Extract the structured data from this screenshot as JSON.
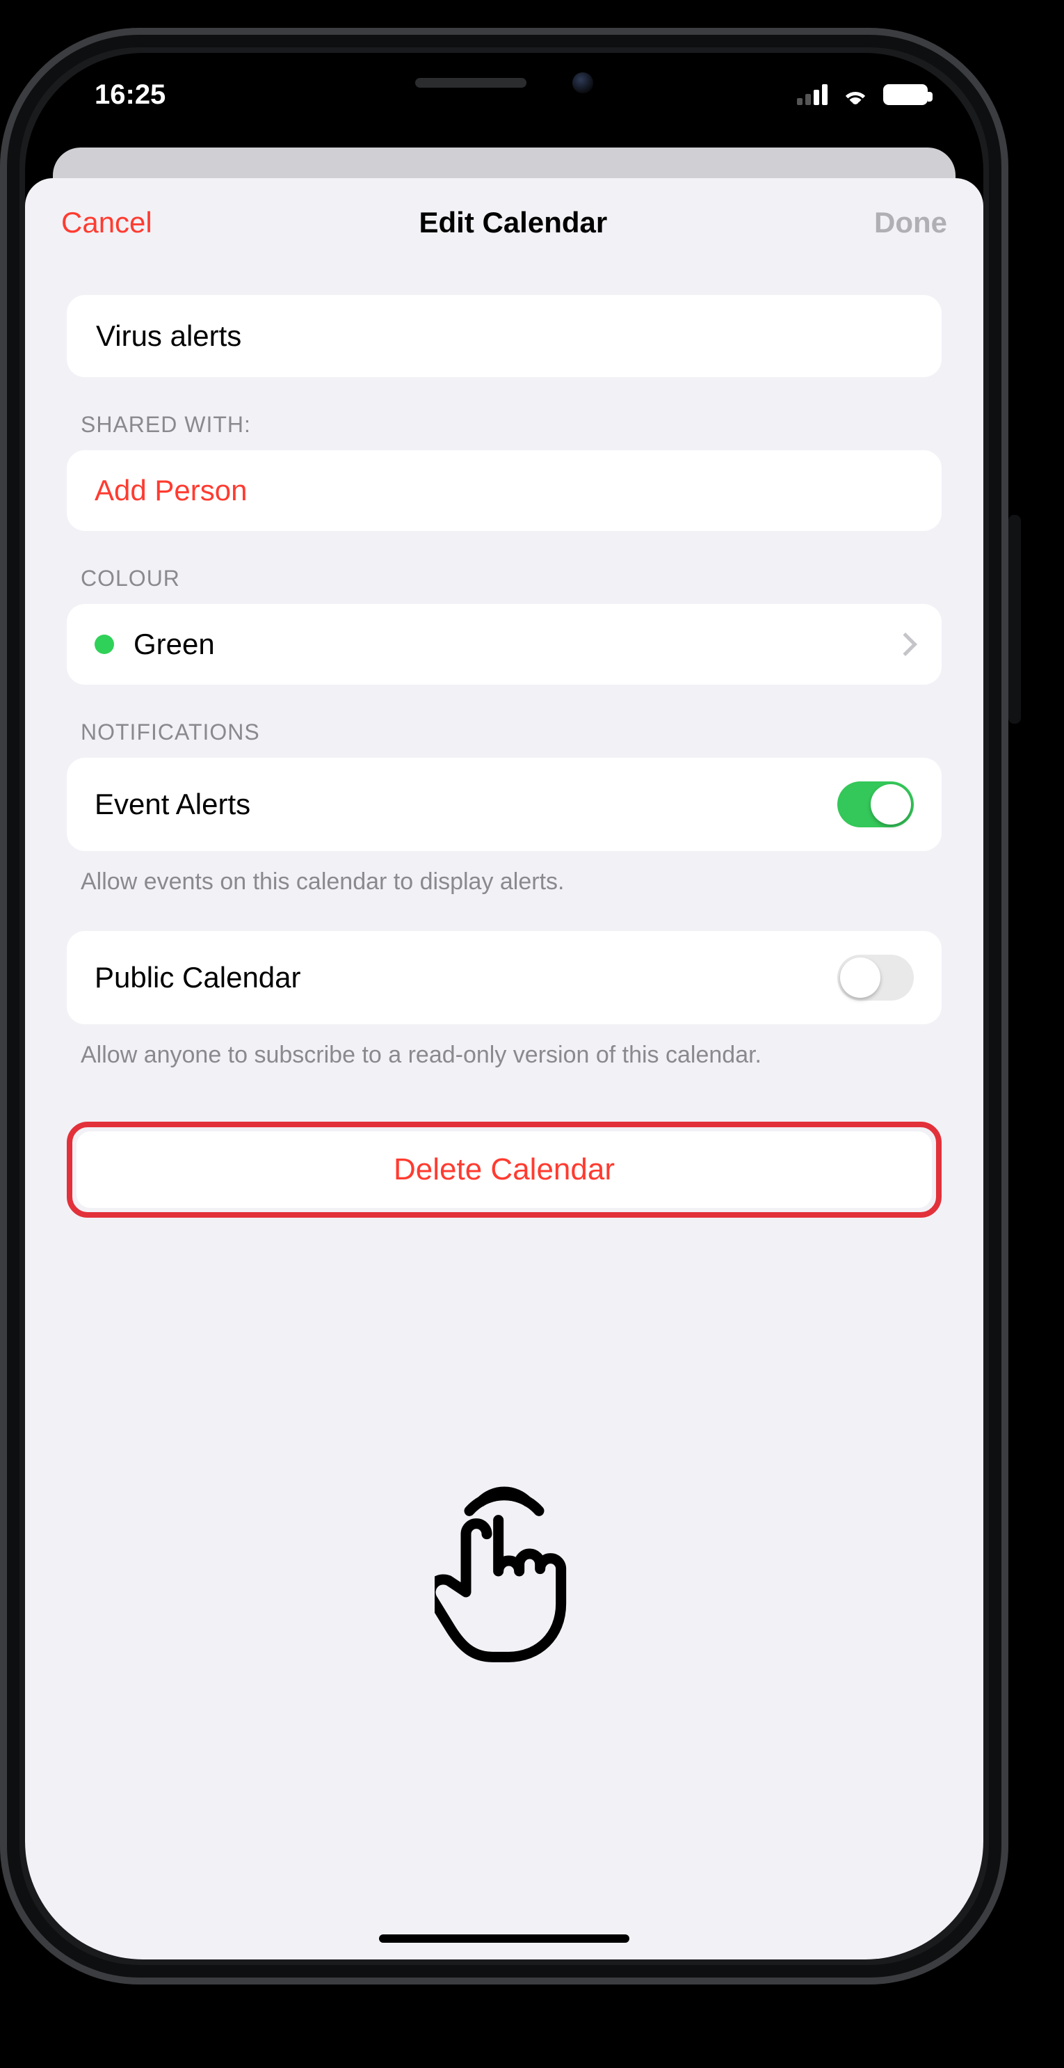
{
  "statusbar": {
    "time": "16:25"
  },
  "nav": {
    "cancel": "Cancel",
    "title": "Edit Calendar",
    "done": "Done"
  },
  "name_field": {
    "value": "Virus alerts"
  },
  "shared": {
    "header": "SHARED WITH:",
    "add_person": "Add Person"
  },
  "colour": {
    "header": "COLOUR",
    "value": "Green",
    "hex": "#30d158"
  },
  "notifications": {
    "header": "NOTIFICATIONS",
    "event_alerts_label": "Event Alerts",
    "event_alerts_on": true,
    "event_alerts_footer": "Allow events on this calendar to display alerts.",
    "public_label": "Public Calendar",
    "public_on": false,
    "public_footer": "Allow anyone to subscribe to a read-only version of this calendar."
  },
  "delete": {
    "label": "Delete Calendar"
  },
  "annotation": {
    "highlight_target": "delete-calendar-button",
    "gesture": "tap"
  }
}
